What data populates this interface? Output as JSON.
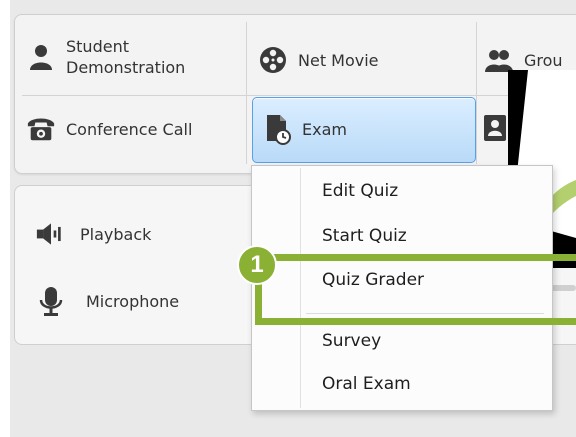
{
  "toolbar": {
    "student_demo_line1": "Student",
    "student_demo_line2": "Demonstration",
    "net_movie": "Net Movie",
    "group": "Grou",
    "conference_call": "Conference Call",
    "exam": "Exam"
  },
  "audio": {
    "playback": "Playback",
    "microphone": "Microphone"
  },
  "exam_menu": {
    "items": [
      "Edit Quiz",
      "Start Quiz",
      "Quiz Grader",
      "Survey",
      "Oral Exam"
    ]
  },
  "callout": {
    "number": "1",
    "color": "#8ab133"
  },
  "icons": {
    "student": "person-icon",
    "net_movie": "film-reel-icon",
    "group": "group-icon",
    "conference": "telephone-icon",
    "exam": "exam-document-clock-icon",
    "playback": "speaker-icon",
    "microphone": "microphone-icon"
  },
  "colors": {
    "selected_button": "#b9daf8",
    "selected_border": "#5aa0e6",
    "highlight": "#8ab133"
  }
}
